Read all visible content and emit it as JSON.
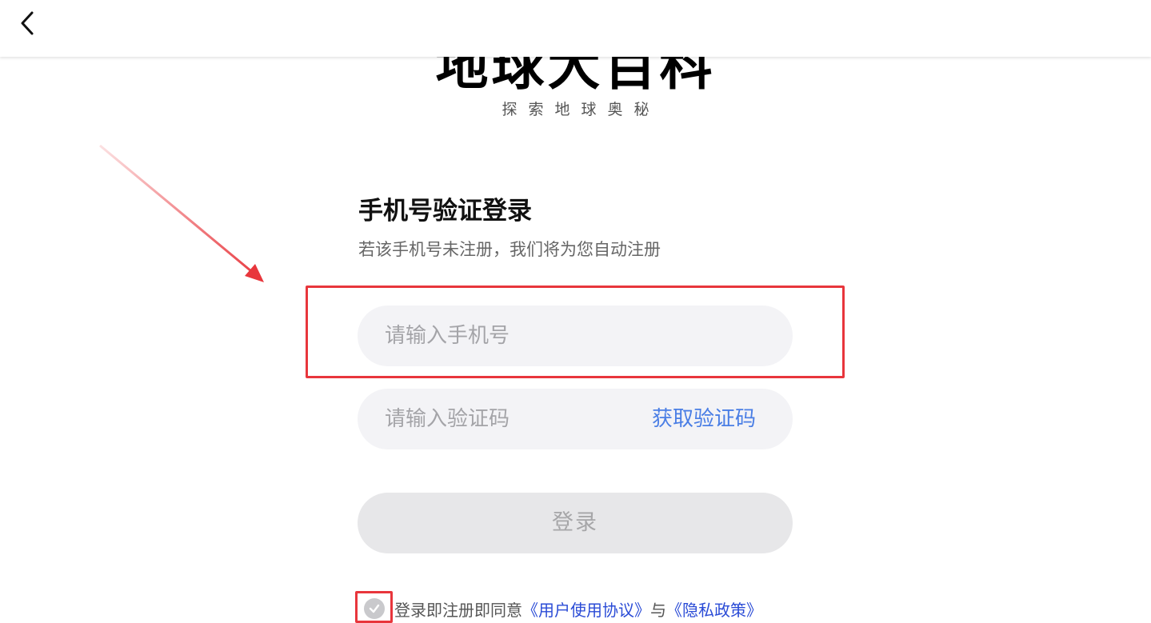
{
  "app": {
    "title": "地球大百科",
    "subtitle": "探索地球奥秘"
  },
  "header": {
    "back_icon": "chevron-left-icon"
  },
  "form": {
    "title": "手机号验证登录",
    "hint": "若该手机号未注册，我们将为您自动注册",
    "phone_placeholder": "请输入手机号",
    "phone_value": "",
    "code_placeholder": "请输入验证码",
    "code_value": "",
    "get_code_label": "获取验证码",
    "login_label": "登录"
  },
  "agreement": {
    "checkbox_icon": "check-circle-icon",
    "checked": false,
    "prefix": "登录即注册即同意",
    "user_agreement": "《用户使用协议》",
    "conjunction": "与",
    "privacy_policy": "《隐私政策》"
  },
  "colors": {
    "accent": "#4a7ee5",
    "link": "#2a4bd6",
    "annotation": "#e8363c",
    "field_bg": "#f3f3f6",
    "button_disabled_bg": "#e7e7e9"
  }
}
